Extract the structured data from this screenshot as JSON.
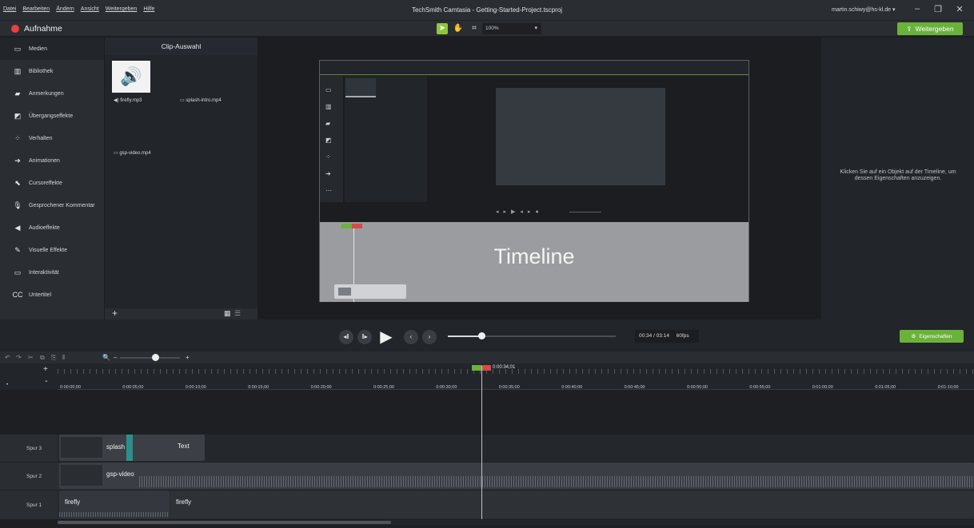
{
  "window": {
    "menu": [
      "Datei",
      "Bearbeiten",
      "Ändern",
      "Ansicht",
      "Weitergeben",
      "Hilfe"
    ],
    "title": "TechSmith Camtasia - Getting-Started-Project.tscproj",
    "user": "martin.schiwy@hs-kl.de ▾",
    "min": "–",
    "max": "❐",
    "close": "✕"
  },
  "toolbar": {
    "record_label": "Aufnahme",
    "zoom_value": "100%",
    "share_label": "Weitergeben"
  },
  "sidebar": {
    "items": [
      {
        "label": "Medien",
        "icon": "media-icon",
        "glyph": "▭"
      },
      {
        "label": "Bibliothek",
        "icon": "library-icon",
        "glyph": "▥"
      },
      {
        "label": "Anmerkungen",
        "icon": "annotation-icon",
        "glyph": "▰"
      },
      {
        "label": "Übergangseffekte",
        "icon": "transition-icon",
        "glyph": "◩"
      },
      {
        "label": "Verhalten",
        "icon": "behavior-icon",
        "glyph": "⁘"
      },
      {
        "label": "Animationen",
        "icon": "animation-icon",
        "glyph": "➔"
      },
      {
        "label": "Cursoreffekte",
        "icon": "cursor-icon",
        "glyph": "⬉"
      },
      {
        "label": "Gesprochener Kommentar",
        "icon": "microphone-icon",
        "glyph": "🎙"
      },
      {
        "label": "Audioeffekte",
        "icon": "audio-icon",
        "glyph": "◀"
      },
      {
        "label": "Visuelle Effekte",
        "icon": "wand-icon",
        "glyph": "✎"
      },
      {
        "label": "Interaktivität",
        "icon": "interactive-icon",
        "glyph": "▭"
      },
      {
        "label": "Untertitel",
        "icon": "cc-icon",
        "glyph": "CC"
      }
    ]
  },
  "clips": {
    "header": "Clip-Auswahl",
    "files": [
      "firefly.mp3",
      "splash-intro.mp4",
      "gsp-video.mp4"
    ]
  },
  "preview": {
    "timeline_caption": "Timeline"
  },
  "properties": {
    "hint": "Klicken Sie auf ein Objekt auf der Timeline, um dessen Eigenschaften anzuzeigen.",
    "button_label": "Eigenschaften"
  },
  "playback": {
    "time": "00:34 / 03:14",
    "fps": "60fps",
    "progress_fraction": 0.175
  },
  "timeline": {
    "playhead_time": "0:00:34;01",
    "ticks": [
      "0:00:00;00",
      "0:00:05;00",
      "0:00:10;00",
      "0:00:15;00",
      "0:00:20;00",
      "0:00:25;00",
      "0:00:30;00",
      "0:00:35;00",
      "0:00:40;00",
      "0:00:45;00",
      "0:00:50;00",
      "0:00:55;00",
      "0:01:00;00",
      "0:01:05;00",
      "0:01:10;00"
    ],
    "tracks": [
      {
        "label": "Spur 3",
        "clips": [
          "splash",
          "Text"
        ]
      },
      {
        "label": "Spur 2",
        "clips": [
          "gsp-video"
        ]
      },
      {
        "label": "Spur 1",
        "clips": [
          "firefly",
          "firefly"
        ]
      }
    ]
  },
  "colors": {
    "accent": "#6ab23a",
    "record": "#e84040"
  }
}
